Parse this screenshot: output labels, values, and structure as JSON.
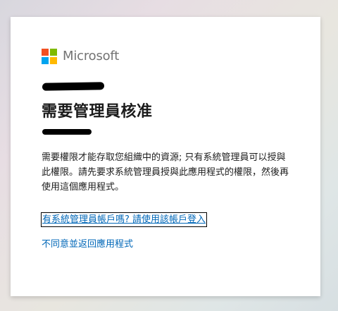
{
  "brand": {
    "name": "Microsoft",
    "logo_colors": [
      "#f25022",
      "#7fba00",
      "#00a4ef",
      "#ffb900"
    ]
  },
  "dialog": {
    "title": "需要管理員核准",
    "description": "需要權限才能存取您組織中的資源; 只有系統管理員可以授與此權限。請先要求系統管理員授與此應用程式的權限，然後再使用這個應用程式。",
    "admin_signin_link": "有系統管理員帳戶嗎? 請使用該帳戶登入",
    "decline_link": "不同意並返回應用程式"
  },
  "colors": {
    "link": "#0067b8",
    "text": "#1b1b1b",
    "wordmark": "#737373"
  }
}
